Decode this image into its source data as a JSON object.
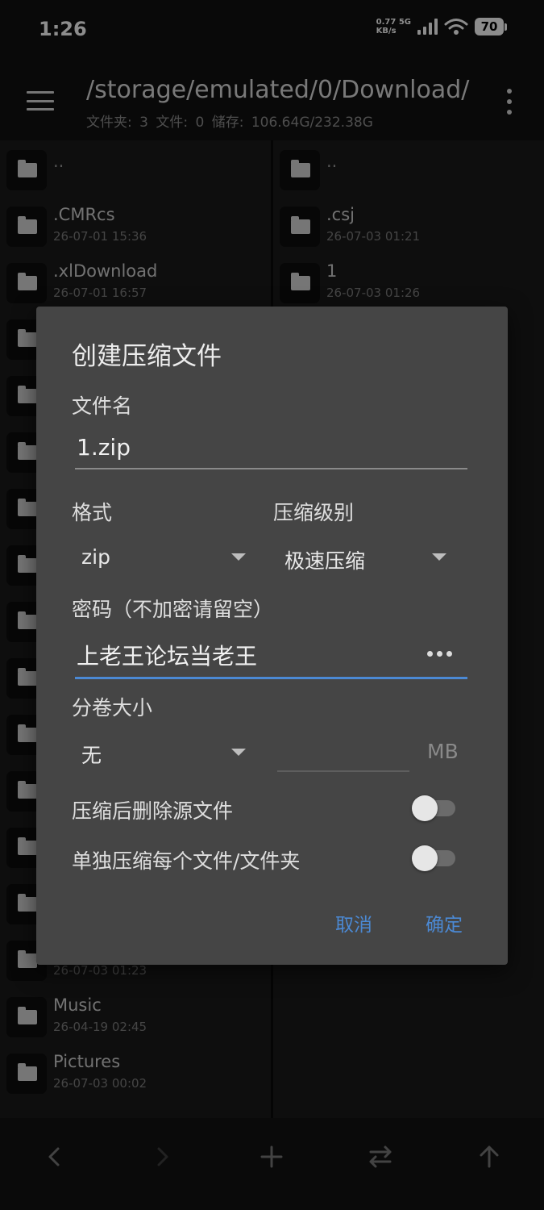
{
  "status_bar": {
    "time": "1:26",
    "net_speed_value": "0.77",
    "net_speed_unit": "KB/s",
    "network": "5G",
    "battery": "70"
  },
  "app_bar": {
    "path": "/storage/emulated/0/Download/",
    "info": "文件夹: 3 文件: 0 储存: 106.64G/232.38G",
    "menu_icon": "hamburger-menu-icon",
    "more_icon": "more-vertical-icon"
  },
  "left_pane": {
    "top_items": [
      {
        "name": "..",
        "date": ""
      },
      {
        "name": ".CMRcs",
        "date": "26-07-01 15:36"
      },
      {
        "name": ".xlDownload",
        "date": "26-07-01 16:57"
      }
    ],
    "bottom_items": [
      {
        "name": "",
        "date": "26-07-03 01:23"
      },
      {
        "name": "Music",
        "date": "26-04-19 02:45"
      },
      {
        "name": "Pictures",
        "date": "26-07-03 00:02"
      }
    ]
  },
  "right_pane": {
    "items": [
      {
        "name": "..",
        "date": ""
      },
      {
        "name": ".csj",
        "date": "26-07-03 01:21"
      },
      {
        "name": "1",
        "date": "26-07-03 01:26"
      }
    ]
  },
  "dialog": {
    "title": "创建压缩文件",
    "filename_label": "文件名",
    "filename_value": "1.zip",
    "format_label": "格式",
    "format_value": "zip",
    "level_label": "压缩级别",
    "level_value": "极速压缩",
    "password_label": "密码（不加密请留空）",
    "password_value": "上老王论坛当老王",
    "volume_label": "分卷大小",
    "volume_value": "无",
    "volume_unit": "MB",
    "delete_source_label": "压缩后删除源文件",
    "delete_source_on": false,
    "separate_label": "单独压缩每个文件/文件夹",
    "separate_on": false,
    "cancel_label": "取消",
    "ok_label": "确定",
    "accent_color": "#4b89d4"
  },
  "bottom_bar": {
    "icons": [
      "back-chevron-icon",
      "forward-chevron-icon",
      "add-icon",
      "swap-icon",
      "up-arrow-icon"
    ]
  }
}
